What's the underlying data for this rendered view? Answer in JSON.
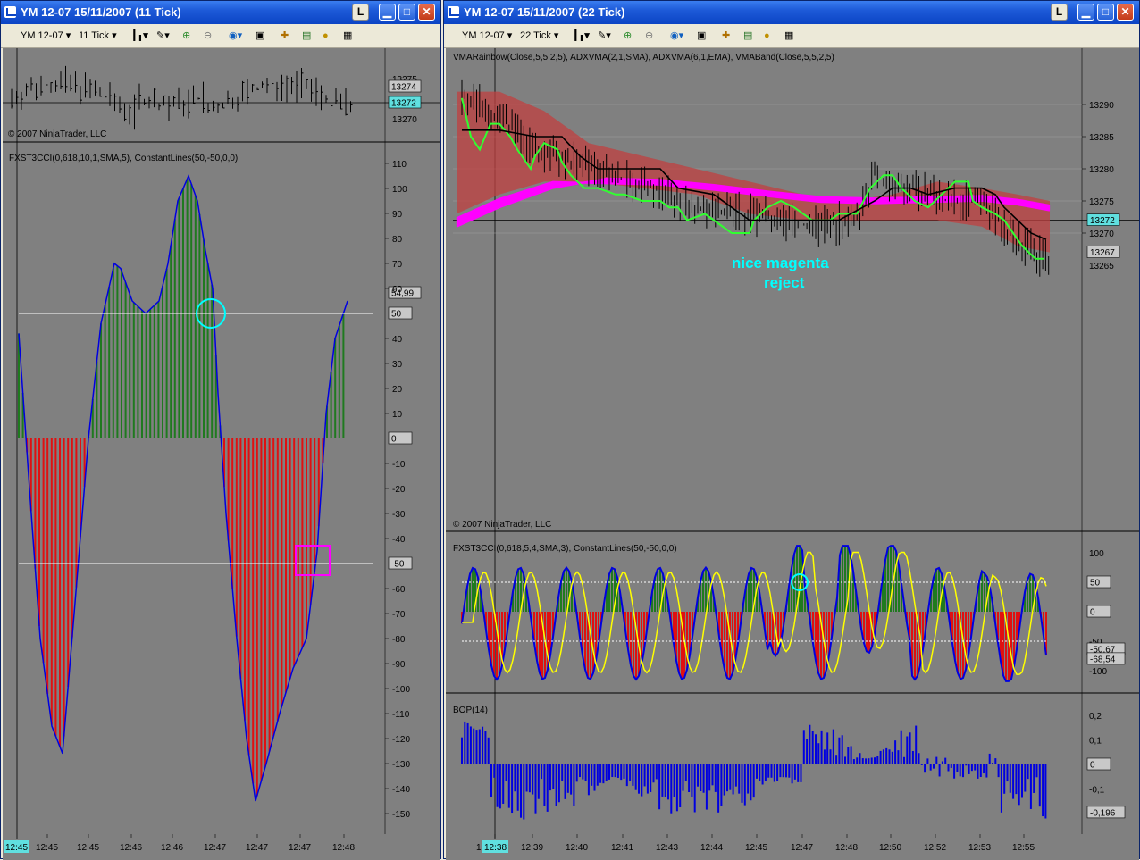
{
  "left_window": {
    "title": "YM 12-07  15/11/2007  (11 Tick)",
    "toolbar": {
      "instrument": "YM 12-07",
      "interval": "11 Tick"
    },
    "price_panel": {
      "copyright": "© 2007 NinjaTrader, LLC",
      "price_labels": [
        "13275",
        "13274",
        "13272",
        "13270"
      ],
      "last_price": "13272"
    },
    "cci_panel": {
      "title": "FXST3CCI(0,618,10,1,SMA,5), ConstantLines(50,-50,0,0)",
      "y_labels": [
        "110",
        "100",
        "90",
        "80",
        "70",
        "60",
        "50",
        "40",
        "30",
        "20",
        "10",
        "0",
        "-10",
        "-20",
        "-30",
        "-40",
        "-50",
        "-60",
        "-70",
        "-80",
        "-90",
        "-100",
        "-110",
        "-120",
        "-130",
        "-140",
        "-150"
      ],
      "value_box": "54,99"
    },
    "time_labels": [
      "12:45",
      "12:45",
      "12:46",
      "12:46",
      "12:47",
      "12:47",
      "12:47",
      "12:48"
    ],
    "cursor_time": "12:45"
  },
  "right_window": {
    "title": "YM 12-07  15/11/2007  (22 Tick)",
    "toolbar": {
      "instrument": "YM 12-07",
      "interval": "22 Tick"
    },
    "price_panel": {
      "title": "VMARainbow(Close,5,5,2,5), ADXVMA(2,1,SMA), ADXVMA(6,1,EMA), VMABand(Close,5,5,2,5)",
      "annotation": [
        "nice magenta",
        "reject"
      ],
      "copyright": "© 2007 NinjaTrader, LLC",
      "y_labels": [
        "13290",
        "13285",
        "13280",
        "13275",
        "13270",
        "13267",
        "13265"
      ],
      "last_price": "13272"
    },
    "cci_panel": {
      "title": "FXST3CCI(0,618,5,4,SMA,3), ConstantLines(50,-50,0,0)",
      "y_labels": [
        "100",
        "50",
        "0",
        "-50",
        "-100"
      ],
      "value_boxes": [
        "-50,67",
        "-68,54"
      ]
    },
    "bop_panel": {
      "title": "BOP(14)",
      "y_labels": [
        "0,2",
        "0,1",
        "0",
        "-0,1",
        "-0,196"
      ]
    },
    "time_labels": [
      "12:38",
      "12:39",
      "12:40",
      "12:41",
      "12:43",
      "12:44",
      "12:45",
      "12:47",
      "12:48",
      "12:50",
      "12:52",
      "12:53",
      "12:55"
    ],
    "cursor_time": "12:38"
  },
  "colors": {
    "chart_bg": "#808080",
    "cci_up": "#1f7a1f",
    "cci_down": "#e01010",
    "cci_line": "#0000e0",
    "signal_line": "#ffff00",
    "magenta": "#ff00ff",
    "cyan": "#00ffff",
    "band": "#c04040"
  }
}
